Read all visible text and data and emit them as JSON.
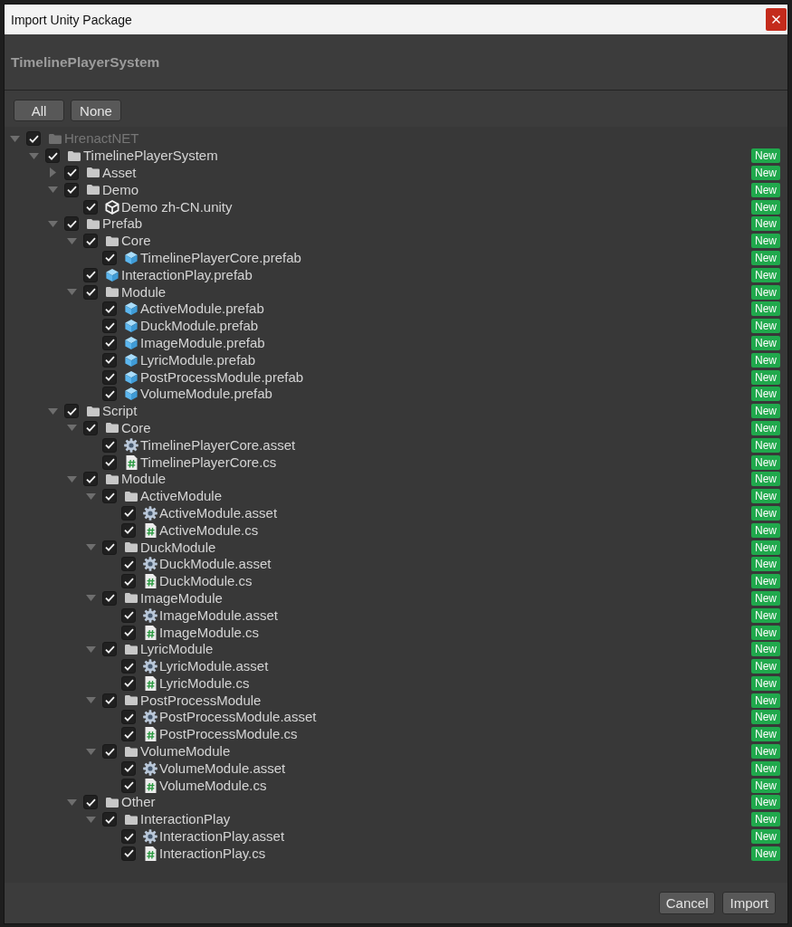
{
  "window": {
    "title": "Import Unity Package"
  },
  "package": {
    "name": "TimelinePlayerSystem"
  },
  "selection_buttons": [
    {
      "label": "All"
    },
    {
      "label": "None"
    }
  ],
  "tree": [
    {
      "kind": "folder",
      "label": "HrenactNET",
      "checked": true,
      "expanded": true,
      "disabled": true,
      "children": [
        {
          "kind": "folder",
          "label": "TimelinePlayerSystem",
          "checked": true,
          "expanded": true,
          "disabled": false,
          "badge": "New",
          "children": [
            {
              "kind": "folder",
              "label": "Asset",
              "checked": true,
              "expanded": false,
              "disabled": false,
              "badge": "New"
            },
            {
              "kind": "folder",
              "label": "Demo",
              "checked": true,
              "expanded": true,
              "disabled": false,
              "badge": "New",
              "children": [
                {
                  "kind": "scene",
                  "label": "Demo zh-CN.unity",
                  "checked": true,
                  "disabled": false,
                  "badge": "New"
                }
              ]
            },
            {
              "kind": "folder",
              "label": "Prefab",
              "checked": true,
              "expanded": true,
              "disabled": false,
              "badge": "New",
              "children": [
                {
                  "kind": "folder",
                  "label": "Core",
                  "checked": true,
                  "expanded": true,
                  "disabled": false,
                  "badge": "New",
                  "children": [
                    {
                      "kind": "prefab",
                      "label": "TimelinePlayerCore.prefab",
                      "checked": true,
                      "disabled": false,
                      "badge": "New"
                    }
                  ]
                },
                {
                  "kind": "prefab",
                  "label": "InteractionPlay.prefab",
                  "checked": true,
                  "disabled": false,
                  "badge": "New"
                },
                {
                  "kind": "folder",
                  "label": "Module",
                  "checked": true,
                  "expanded": true,
                  "disabled": false,
                  "badge": "New",
                  "children": [
                    {
                      "kind": "prefab",
                      "label": "ActiveModule.prefab",
                      "checked": true,
                      "disabled": false,
                      "badge": "New"
                    },
                    {
                      "kind": "prefab",
                      "label": "DuckModule.prefab",
                      "checked": true,
                      "disabled": false,
                      "badge": "New"
                    },
                    {
                      "kind": "prefab",
                      "label": "ImageModule.prefab",
                      "checked": true,
                      "disabled": false,
                      "badge": "New"
                    },
                    {
                      "kind": "prefab",
                      "label": "LyricModule.prefab",
                      "checked": true,
                      "disabled": false,
                      "badge": "New"
                    },
                    {
                      "kind": "prefab",
                      "label": "PostProcessModule.prefab",
                      "checked": true,
                      "disabled": false,
                      "badge": "New"
                    },
                    {
                      "kind": "prefab",
                      "label": "VolumeModule.prefab",
                      "checked": true,
                      "disabled": false,
                      "badge": "New"
                    }
                  ]
                }
              ]
            },
            {
              "kind": "folder",
              "label": "Script",
              "checked": true,
              "expanded": true,
              "disabled": false,
              "badge": "New",
              "children": [
                {
                  "kind": "folder",
                  "label": "Core",
                  "checked": true,
                  "expanded": true,
                  "disabled": false,
                  "badge": "New",
                  "children": [
                    {
                      "kind": "asset",
                      "label": "TimelinePlayerCore.asset",
                      "checked": true,
                      "disabled": false,
                      "badge": "New"
                    },
                    {
                      "kind": "script",
                      "label": "TimelinePlayerCore.cs",
                      "checked": true,
                      "disabled": false,
                      "badge": "New"
                    }
                  ]
                },
                {
                  "kind": "folder",
                  "label": "Module",
                  "checked": true,
                  "expanded": true,
                  "disabled": false,
                  "badge": "New",
                  "children": [
                    {
                      "kind": "folder",
                      "label": "ActiveModule",
                      "checked": true,
                      "expanded": true,
                      "disabled": false,
                      "badge": "New",
                      "children": [
                        {
                          "kind": "asset",
                          "label": "ActiveModule.asset",
                          "checked": true,
                          "disabled": false,
                          "badge": "New"
                        },
                        {
                          "kind": "script",
                          "label": "ActiveModule.cs",
                          "checked": true,
                          "disabled": false,
                          "badge": "New"
                        }
                      ]
                    },
                    {
                      "kind": "folder",
                      "label": "DuckModule",
                      "checked": true,
                      "expanded": true,
                      "disabled": false,
                      "badge": "New",
                      "children": [
                        {
                          "kind": "asset",
                          "label": "DuckModule.asset",
                          "checked": true,
                          "disabled": false,
                          "badge": "New"
                        },
                        {
                          "kind": "script",
                          "label": "DuckModule.cs",
                          "checked": true,
                          "disabled": false,
                          "badge": "New"
                        }
                      ]
                    },
                    {
                      "kind": "folder",
                      "label": "ImageModule",
                      "checked": true,
                      "expanded": true,
                      "disabled": false,
                      "badge": "New",
                      "children": [
                        {
                          "kind": "asset",
                          "label": "ImageModule.asset",
                          "checked": true,
                          "disabled": false,
                          "badge": "New"
                        },
                        {
                          "kind": "script",
                          "label": "ImageModule.cs",
                          "checked": true,
                          "disabled": false,
                          "badge": "New"
                        }
                      ]
                    },
                    {
                      "kind": "folder",
                      "label": "LyricModule",
                      "checked": true,
                      "expanded": true,
                      "disabled": false,
                      "badge": "New",
                      "children": [
                        {
                          "kind": "asset",
                          "label": "LyricModule.asset",
                          "checked": true,
                          "disabled": false,
                          "badge": "New"
                        },
                        {
                          "kind": "script",
                          "label": "LyricModule.cs",
                          "checked": true,
                          "disabled": false,
                          "badge": "New"
                        }
                      ]
                    },
                    {
                      "kind": "folder",
                      "label": "PostProcessModule",
                      "checked": true,
                      "expanded": true,
                      "disabled": false,
                      "badge": "New",
                      "children": [
                        {
                          "kind": "asset",
                          "label": "PostProcessModule.asset",
                          "checked": true,
                          "disabled": false,
                          "badge": "New"
                        },
                        {
                          "kind": "script",
                          "label": "PostProcessModule.cs",
                          "checked": true,
                          "disabled": false,
                          "badge": "New"
                        }
                      ]
                    },
                    {
                      "kind": "folder",
                      "label": "VolumeModule",
                      "checked": true,
                      "expanded": true,
                      "disabled": false,
                      "badge": "New",
                      "children": [
                        {
                          "kind": "asset",
                          "label": "VolumeModule.asset",
                          "checked": true,
                          "disabled": false,
                          "badge": "New"
                        },
                        {
                          "kind": "script",
                          "label": "VolumeModule.cs",
                          "checked": true,
                          "disabled": false,
                          "badge": "New"
                        }
                      ]
                    }
                  ]
                },
                {
                  "kind": "folder",
                  "label": "Other",
                  "checked": true,
                  "expanded": true,
                  "disabled": false,
                  "badge": "New",
                  "children": [
                    {
                      "kind": "folder",
                      "label": "InteractionPlay",
                      "checked": true,
                      "expanded": true,
                      "disabled": false,
                      "badge": "New",
                      "children": [
                        {
                          "kind": "asset",
                          "label": "InteractionPlay.asset",
                          "checked": true,
                          "disabled": false,
                          "badge": "New"
                        },
                        {
                          "kind": "script",
                          "label": "InteractionPlay.cs",
                          "checked": true,
                          "disabled": false,
                          "badge": "New"
                        }
                      ]
                    }
                  ]
                }
              ]
            }
          ]
        }
      ]
    }
  ],
  "footer_buttons": [
    {
      "label": "Cancel"
    },
    {
      "label": "Import"
    }
  ]
}
